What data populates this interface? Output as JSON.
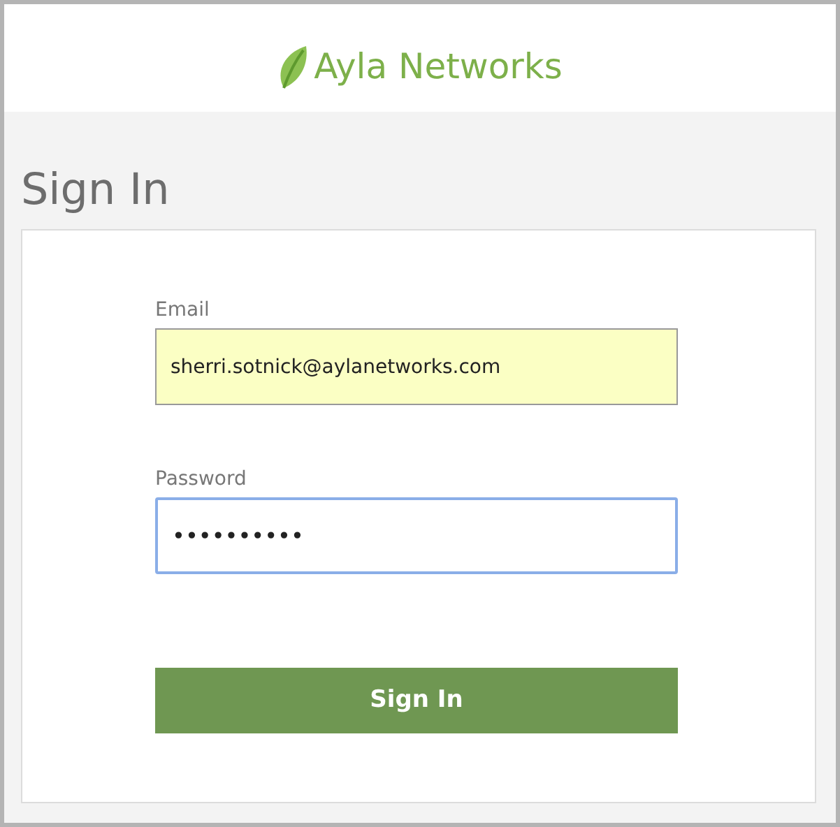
{
  "brand": {
    "name": "Ayla Networks"
  },
  "page_title": "Sign In",
  "fields": [
    {
      "label": "Email",
      "value": "sherri.sotnick@aylanetworks.com",
      "autofilled": true,
      "focused": false
    },
    {
      "label": "Password",
      "value": "••••••••••",
      "autofilled": false,
      "focused": true
    }
  ],
  "submit_button": "Sign In"
}
